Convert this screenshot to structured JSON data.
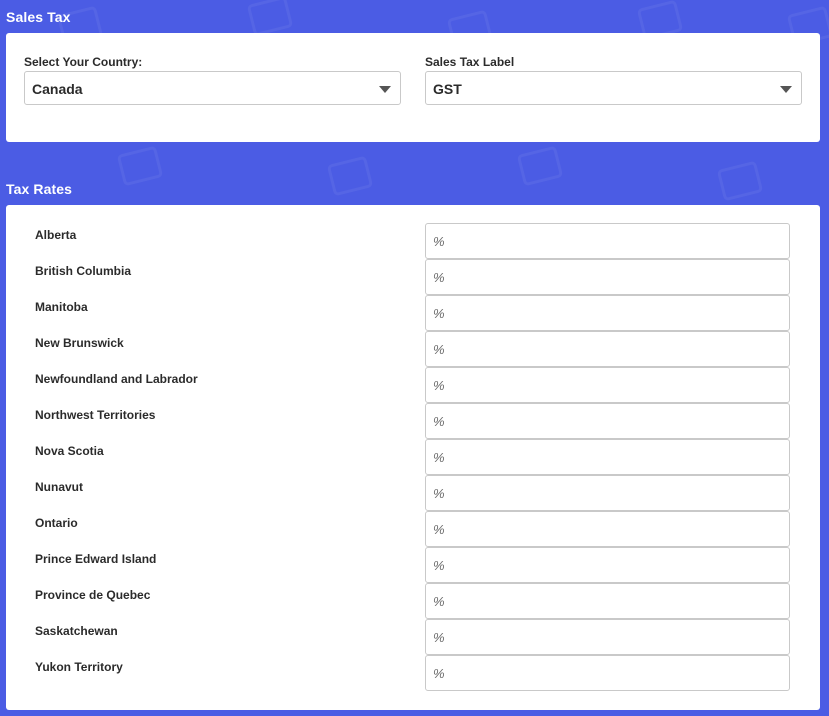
{
  "sales_tax": {
    "title": "Sales Tax",
    "country_label": "Select Your Country:",
    "country_value": "Canada",
    "tax_label_label": "Sales Tax Label",
    "tax_label_value": "GST"
  },
  "tax_rates": {
    "title": "Tax Rates",
    "percent_symbol": "%",
    "provinces": [
      {
        "name": "Alberta",
        "value": ""
      },
      {
        "name": "British Columbia",
        "value": ""
      },
      {
        "name": "Manitoba",
        "value": ""
      },
      {
        "name": "New Brunswick",
        "value": ""
      },
      {
        "name": "Newfoundland and Labrador",
        "value": ""
      },
      {
        "name": "Northwest Territories",
        "value": ""
      },
      {
        "name": "Nova Scotia",
        "value": ""
      },
      {
        "name": "Nunavut",
        "value": ""
      },
      {
        "name": "Ontario",
        "value": ""
      },
      {
        "name": "Prince Edward Island",
        "value": ""
      },
      {
        "name": "Province de Quebec",
        "value": ""
      },
      {
        "name": "Saskatchewan",
        "value": ""
      },
      {
        "name": "Yukon Territory",
        "value": ""
      }
    ]
  },
  "colors": {
    "background": "#4b5ce4",
    "card": "#ffffff",
    "border": "#c9c9c9"
  },
  "icons": {
    "dropdown": "chevron-down-icon",
    "percent": "percent-icon"
  }
}
